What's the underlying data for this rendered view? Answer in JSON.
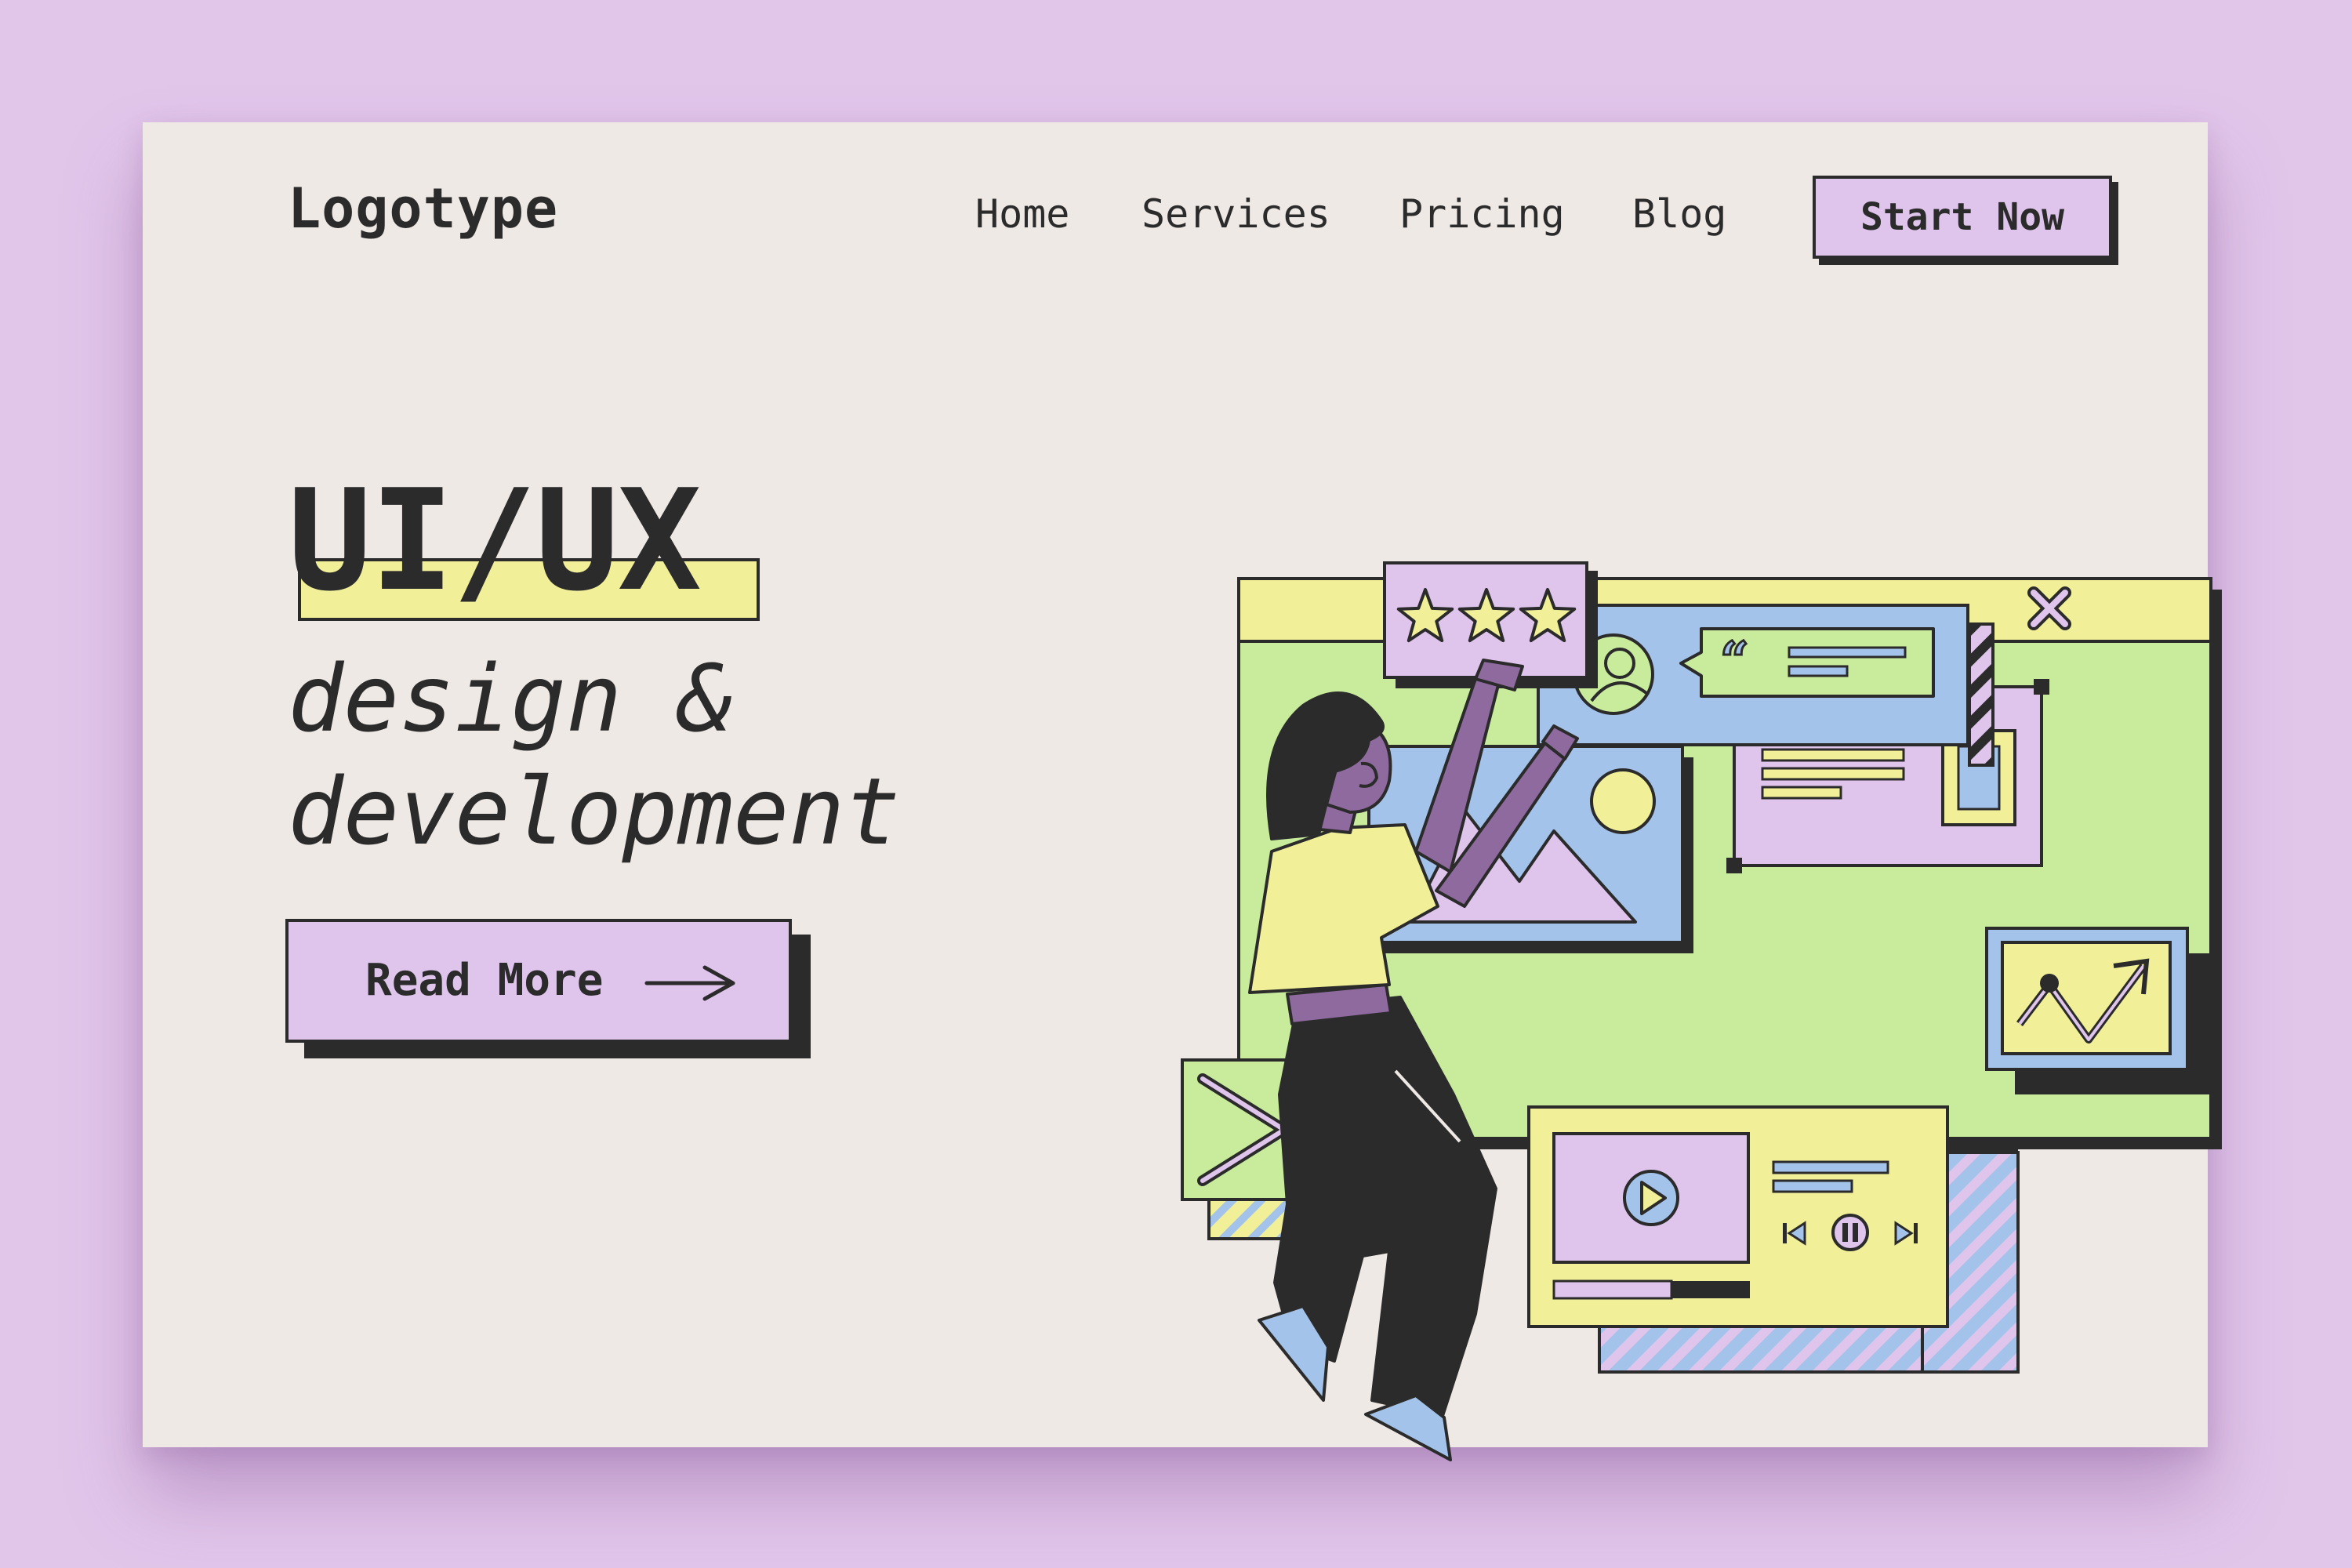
{
  "brand": {
    "logo": "Logotype"
  },
  "nav": {
    "items": [
      "Home",
      "Services",
      "Pricing",
      "Blog"
    ],
    "cta": "Start Now"
  },
  "hero": {
    "title": "UI/UX",
    "subtitle_line1": "design &",
    "subtitle_line2": "development",
    "button": "Read More"
  },
  "colors": {
    "background": "#e2c6ea",
    "page": "#efe9e6",
    "lavender": "#dfc4ec",
    "yellow": "#f1f098",
    "green": "#c8eb9c",
    "blue": "#a4c3ea",
    "purple": "#8e6a9e",
    "ink": "#2b2b2b"
  },
  "illustration": {
    "rating_stars": 3,
    "video_progress": 0.6
  }
}
